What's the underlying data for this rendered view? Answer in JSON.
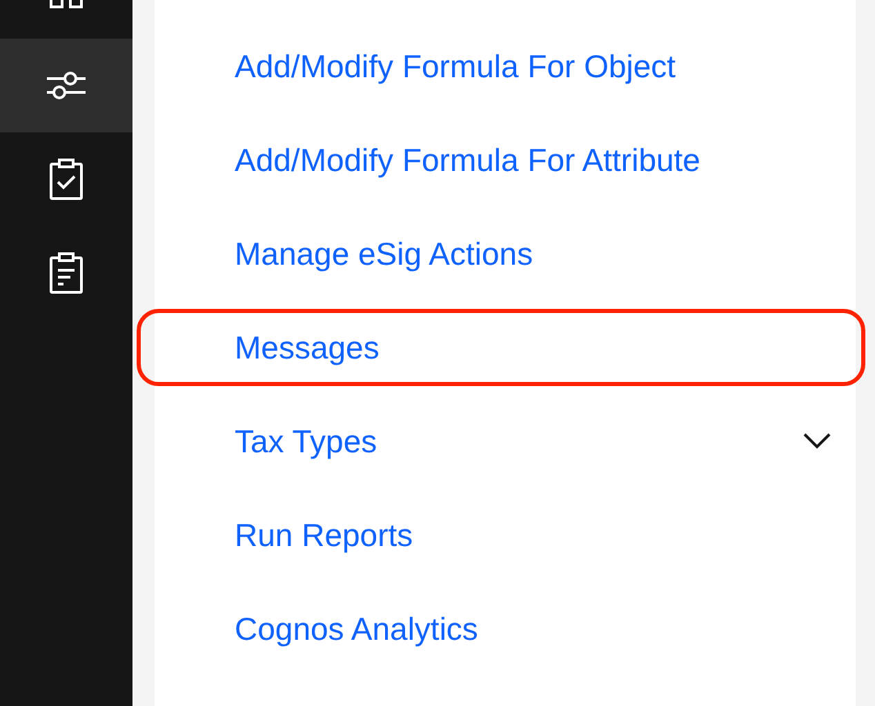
{
  "rail": [
    {
      "selected": false
    },
    {
      "selected": true
    },
    {
      "selected": false
    },
    {
      "selected": false
    }
  ],
  "menu": [
    {
      "label": "Add/Modify Formula For Object",
      "kind": "link",
      "highlighted": false
    },
    {
      "label": "Add/Modify Formula For Attribute",
      "kind": "link",
      "highlighted": false
    },
    {
      "label": "Manage eSig Actions",
      "kind": "link",
      "highlighted": false
    },
    {
      "label": "Messages",
      "kind": "link",
      "highlighted": true
    },
    {
      "label": "Tax Types",
      "kind": "group",
      "expanded": false,
      "highlighted": false
    },
    {
      "label": "Run Reports",
      "kind": "link",
      "highlighted": false
    },
    {
      "label": "Cognos Analytics",
      "kind": "link",
      "highlighted": false
    }
  ]
}
